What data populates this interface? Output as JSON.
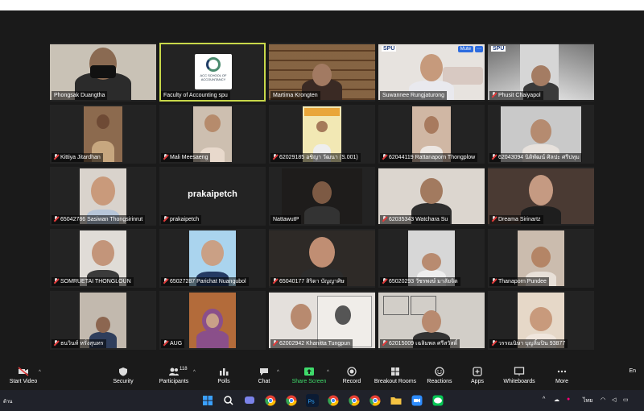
{
  "meeting": {
    "participants": [
      {
        "name": "Phongsak Duangtha",
        "muted": false
      },
      {
        "name": "Faculty of Accounting spu",
        "muted": false,
        "active": true,
        "logo": "ACC SCHOOL OF ACCOUNTANCY"
      },
      {
        "name": "Martima Krongten",
        "muted": false
      },
      {
        "name": "Suwannee Rungjaturong",
        "muted": false,
        "badge": "SPU",
        "mute_button": "Mute",
        "more_button": "···"
      },
      {
        "name": "Phusit Chaiyapol",
        "muted": true,
        "badge": "SPU"
      },
      {
        "name": "Kittiya Jitardhan",
        "muted": true
      },
      {
        "name": "Mali Meesaeng",
        "muted": true
      },
      {
        "name": "62029185 อชิญา วัฒนา (S.001)",
        "muted": true
      },
      {
        "name": "62044119 Rattanaporn Thongplow",
        "muted": true
      },
      {
        "name": "62043094 นิติพัฒน์ ศิลปะ ศรีปทุม",
        "muted": true
      },
      {
        "name": "65042786 Sasiwan Thongsirinrut",
        "muted": true
      },
      {
        "name": "prakaipetch",
        "muted": true,
        "center_text": "prakaipetch"
      },
      {
        "name": "NattawutP",
        "muted": false
      },
      {
        "name": "62035343 Watchara Su",
        "muted": true
      },
      {
        "name": "Dreama Sirinartz",
        "muted": true
      },
      {
        "name": "SOMRUETAI THONGLOUN",
        "muted": true
      },
      {
        "name": "65027287 Parichat Nuangubol",
        "muted": true
      },
      {
        "name": "65040177 สิริดา บัญญาศิษ",
        "muted": true
      },
      {
        "name": "65020293 วัชรพงษ์ มาลัยจิต",
        "muted": true
      },
      {
        "name": "Thanaporn Pundee",
        "muted": true
      },
      {
        "name": "ธนวินท์ หรั่งสุนทร",
        "muted": true
      },
      {
        "name": "AUG",
        "muted": true
      },
      {
        "name": "62002942 Khanitta Tungpun",
        "muted": true
      },
      {
        "name": "62015009 เฉลิมพล ศรีสวัสดิ์",
        "muted": true
      },
      {
        "name": "วรรณนิษา บุญลิ้มปิน 93877",
        "muted": true
      }
    ]
  },
  "toolbar": {
    "start_video": "Start Video",
    "security": "Security",
    "participants": "Participants",
    "participants_count": "118",
    "polls": "Polls",
    "chat": "Chat",
    "share_screen": "Share Screen",
    "record": "Record",
    "breakout_rooms": "Breakout Rooms",
    "reactions": "Reactions",
    "apps": "Apps",
    "whiteboards": "Whiteboards",
    "more": "More",
    "end": "En"
  },
  "taskbar": {
    "language": "ไทย",
    "left_text": "ต้าน"
  },
  "colors": {
    "active_speaker": "#c8d84a",
    "share_green": "#3fdb6b",
    "muted_red": "#e23b3b"
  }
}
